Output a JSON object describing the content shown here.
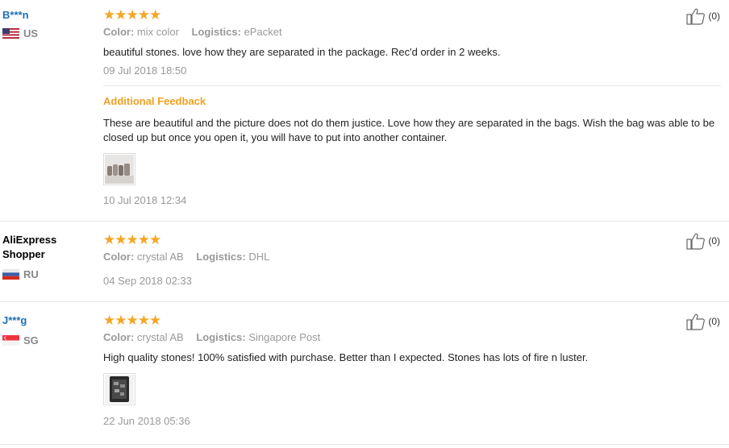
{
  "reviews": [
    {
      "user": "B***n",
      "country": "US",
      "stars": "★★★★★",
      "rating": 5,
      "color_label": "Color:",
      "color": "mix color",
      "logistics_label": "Logistics:",
      "logistics": "ePacket",
      "text": "beautiful stones. love how they are separated in the package. Rec'd order in 2 weeks.",
      "date": "09 Jul 2018 18:50",
      "likes": "(0)",
      "additional": {
        "title": "Additional Feedback",
        "text": "These are beautiful and the picture does not do them justice. Love how they are separated in the bags. Wish the bag was able to be closed up but once you open it, you will have to put into another container.",
        "date": "10 Jul 2018 12:34"
      }
    },
    {
      "user": "AliExpress Shopper",
      "country": "RU",
      "stars": "★★★★★",
      "rating": 5,
      "color_label": "Color:",
      "color": "crystal AB",
      "logistics_label": "Logistics:",
      "logistics": "DHL",
      "date": "04 Sep 2018 02:33",
      "likes": "(0)"
    },
    {
      "user": "J***g",
      "country": "SG",
      "stars": "★★★★★",
      "rating": 5,
      "color_label": "Color:",
      "color": "crystal AB",
      "logistics_label": "Logistics:",
      "logistics": "Singapore Post",
      "text": "High quality stones! 100% satisfied with purchase. Better than I expected. Stones has lots of fire n luster.",
      "date": "22 Jun 2018 05:36",
      "likes": "(0)"
    }
  ],
  "colors": {
    "star": "#f5a623",
    "masked_user": "#1d6fb4",
    "additional_title": "#f0a020",
    "muted": "#999999"
  },
  "icons": {
    "like": "thumbs-up-icon",
    "flags": [
      "us-flag-icon",
      "ru-flag-icon",
      "sg-flag-icon"
    ]
  }
}
